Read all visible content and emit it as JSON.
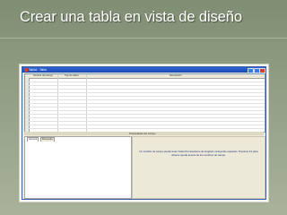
{
  "slide": {
    "title": "Crear una tabla en vista de diseño"
  },
  "window": {
    "title": "Tabla1 : Tabla",
    "controls": [
      "minimize-icon",
      "maximize-icon",
      "close-icon"
    ]
  },
  "grid": {
    "columns": [
      "Nombre del campo",
      "Tipo de datos",
      "Descripción"
    ],
    "row_count": 15
  },
  "properties": {
    "header": "Propiedades del campo",
    "tabs": [
      "General",
      "Búsqueda"
    ],
    "help_text": "Un nombre de campo puede tener hasta 64 caracteres de longitud, incluyendo espacios. Presione F1 para obtener ayuda acerca de los nombres de campo."
  },
  "colors": {
    "background": "#8f9c82",
    "titlebar": "#1b49b3",
    "help_text": "#1a2b78"
  }
}
